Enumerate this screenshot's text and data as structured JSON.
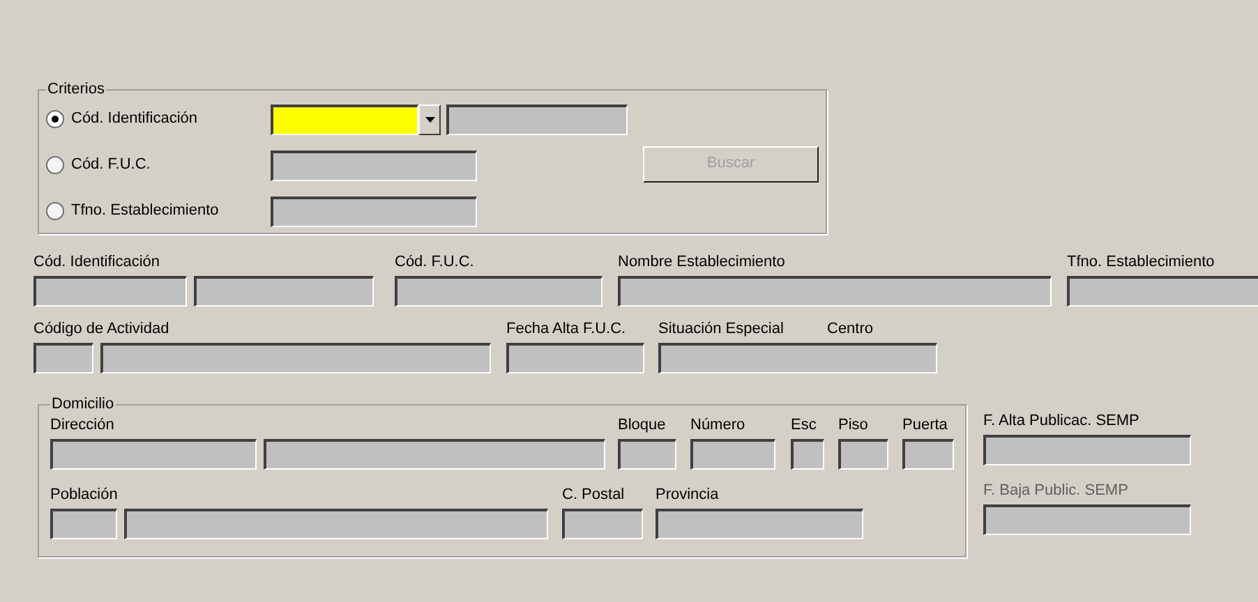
{
  "criterios": {
    "title": "Criterios",
    "options": [
      {
        "label": "Cód. Identificación",
        "selected": true
      },
      {
        "label": "Cód. F.U.C.",
        "selected": false
      },
      {
        "label": "Tfno. Establecimiento",
        "selected": false
      }
    ],
    "combo": {
      "highlighted": true
    },
    "search_button": {
      "label": "Buscar",
      "disabled": true
    }
  },
  "row_1_labels": [
    "Cód. Identificación",
    "Cód. F.U.C.",
    "Nombre Establecimiento",
    "Tfno. Establecimiento"
  ],
  "row_2_labels": [
    "Código de Actividad",
    "Fecha Alta F.U.C.",
    "Situación Especial",
    "Centro"
  ],
  "domicilio": {
    "title": "Domicilio",
    "row_1_labels": [
      "Dirección",
      "Bloque",
      "Número",
      "Esc",
      "Piso",
      "Puerta"
    ],
    "row_2_labels": [
      "Población",
      "C. Postal",
      "Provincia"
    ]
  },
  "publication": [
    {
      "label": "F. Alta Publicac. SEMP",
      "disabled": false
    },
    {
      "label": "F. Baja Public. SEMP",
      "disabled": true
    }
  ]
}
